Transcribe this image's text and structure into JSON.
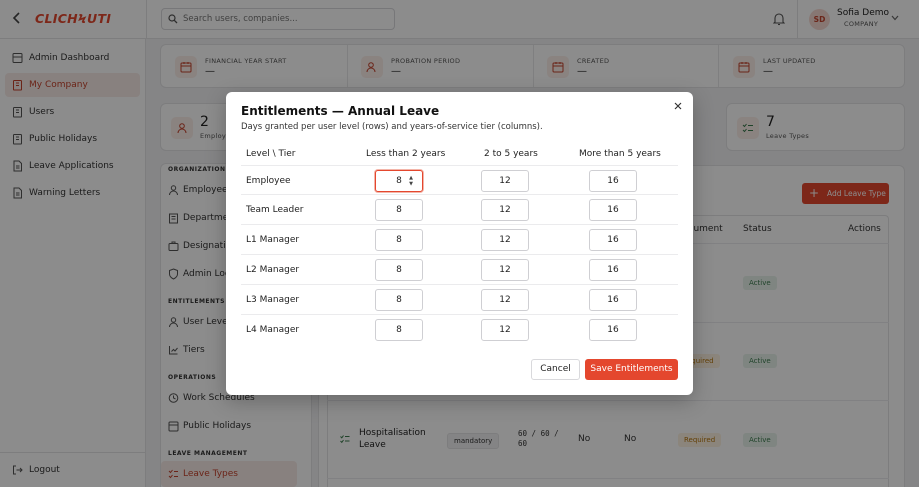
{
  "app": {
    "logo": "CLICHϞUTI",
    "back_icon": "arrow-left-icon"
  },
  "search": {
    "placeholder": "Search users, companies..."
  },
  "user": {
    "initials": "SD",
    "name": "Sofia Demo",
    "role": "COMPANY"
  },
  "sidebar": {
    "items": [
      {
        "label": "Admin Dashboard",
        "icon": "dashboard-icon"
      },
      {
        "label": "My Company",
        "icon": "company-icon",
        "active": true
      },
      {
        "label": "Users",
        "icon": "users-icon"
      },
      {
        "label": "Public Holidays",
        "icon": "calendar-icon"
      },
      {
        "label": "Leave Applications",
        "icon": "document-icon"
      },
      {
        "label": "Warning Letters",
        "icon": "document-icon"
      }
    ],
    "logout": "Logout"
  },
  "stats_top": [
    {
      "label": "FINANCIAL YEAR START",
      "value": "—"
    },
    {
      "label": "PROBATION PERIOD",
      "value": "—"
    },
    {
      "label": "CREATED",
      "value": "—"
    },
    {
      "label": "LAST UPDATED",
      "value": "—"
    }
  ],
  "stats_mid": {
    "employees": {
      "value": "2",
      "label": "Employees"
    },
    "leave_types": {
      "value": "7",
      "label": "Leave Types"
    }
  },
  "nav": {
    "organization_title": "ORGANIZATION",
    "organization": [
      "Employees",
      "Departments",
      "Designations",
      "Admin Logs"
    ],
    "entitlements_title": "ENTITLEMENTS",
    "entitlements": [
      "User Levels",
      "Tiers"
    ],
    "operations_title": "OPERATIONS",
    "operations": [
      "Work Schedules",
      "Public Holidays"
    ],
    "leave_title": "LEAVE MANAGEMENT",
    "leave": [
      "Leave Types"
    ]
  },
  "table": {
    "add_label": "Add Leave Type",
    "headers": {
      "document": "ocument",
      "status": "Status",
      "actions": "Actions"
    },
    "rows": [
      {
        "status": "Active"
      },
      {
        "document": "equired",
        "status": "Active"
      },
      {
        "name": "Hospitalisation Leave",
        "type": "mandatory",
        "days": "60 / 60 / 60",
        "col4": "No",
        "col5": "No",
        "document": "Required",
        "status": "Active"
      }
    ]
  },
  "modal": {
    "title": "Entitlements — Annual Leave",
    "subtitle": "Days granted per user level (rows) and years-of-service tier (columns).",
    "headers": [
      "Level \\ Tier",
      "Less than 2 years",
      "2 to 5 years",
      "More than 5 years"
    ],
    "rows": [
      {
        "level": "Employee",
        "values": [
          "8",
          "12",
          "16"
        ]
      },
      {
        "level": "Team Leader",
        "values": [
          "8",
          "12",
          "16"
        ]
      },
      {
        "level": "L1 Manager",
        "values": [
          "8",
          "12",
          "16"
        ]
      },
      {
        "level": "L2 Manager",
        "values": [
          "8",
          "12",
          "16"
        ]
      },
      {
        "level": "L3 Manager",
        "values": [
          "8",
          "12",
          "16"
        ]
      },
      {
        "level": "L4 Manager",
        "values": [
          "8",
          "12",
          "16"
        ]
      }
    ],
    "cancel": "Cancel",
    "save": "Save Entitlements"
  },
  "colors": {
    "accent": "#e4472e",
    "active_bg": "#f8ece8"
  }
}
